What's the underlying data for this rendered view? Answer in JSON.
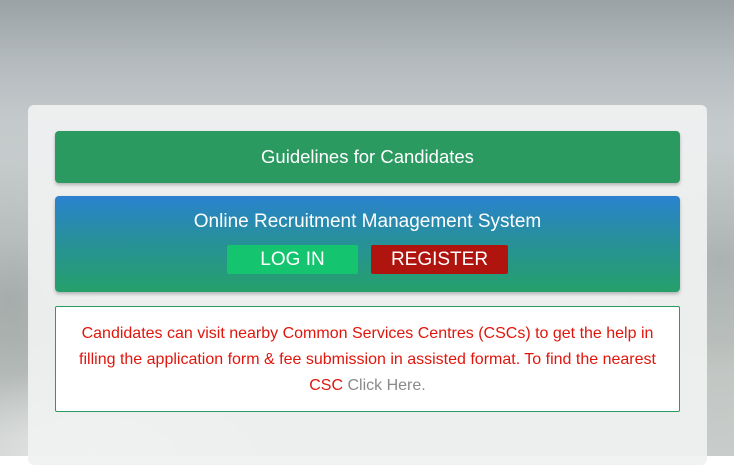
{
  "guidelines": {
    "label": "Guidelines for Candidates"
  },
  "recruitment": {
    "title": "Online Recruitment Management System",
    "login_label": "LOG IN",
    "register_label": "REGISTER"
  },
  "notice": {
    "text": "Candidates can visit nearby Common Services Centres (CSCs) to get the help in filling the application form & fee submission in assisted format. To find the nearest CSC ",
    "link_label": "Click Here",
    "trailing": "."
  },
  "colors": {
    "guidelines_bg": "#2a9a61",
    "login_bg": "#14c46e",
    "register_bg": "#b0140f",
    "notice_text": "#e0150c",
    "link_text": "#8a8a8a"
  }
}
